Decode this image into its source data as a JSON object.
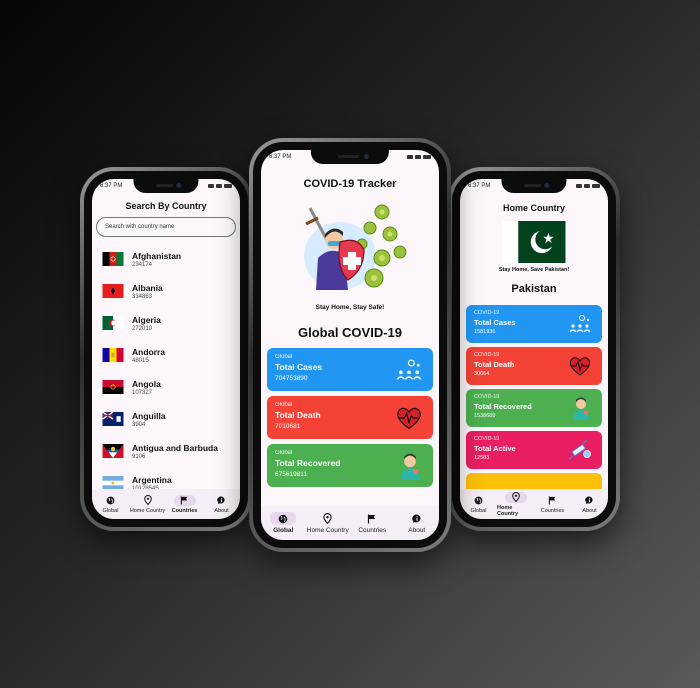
{
  "nav": [
    "Global",
    "Home Country",
    "Countries",
    "About"
  ],
  "left": {
    "time": "6:37 PM",
    "title": "Search By Country",
    "search_placeholder": "Search with country name",
    "countries": [
      {
        "name": "Afghanistan",
        "value": "234174"
      },
      {
        "name": "Albania",
        "value": "334863"
      },
      {
        "name": "Algeria",
        "value": "272010"
      },
      {
        "name": "Andorra",
        "value": "48015"
      },
      {
        "name": "Angola",
        "value": "107327"
      },
      {
        "name": "Anguilla",
        "value": "3904"
      },
      {
        "name": "Antigua and Barbuda",
        "value": "9106"
      },
      {
        "name": "Argentina",
        "value": "10128545"
      }
    ],
    "active_nav": "Countries"
  },
  "middle": {
    "time": "6:37 PM",
    "title": "COVID-19 Tracker",
    "tagline": "Stay Home, Stay Safe!",
    "section_title": "Global COVID-19",
    "cards": [
      {
        "small": "Global",
        "title": "Total Cases",
        "value": "704753890",
        "color": "#2196f3"
      },
      {
        "small": "Global",
        "title": "Total Death",
        "value": "7010681",
        "color": "#f44336"
      },
      {
        "small": "Global",
        "title": "Total Recovered",
        "value": "675619811",
        "color": "#4caf50"
      }
    ],
    "active_nav": "Global"
  },
  "right": {
    "time": "6:37 PM",
    "title": "Home Country",
    "tagline": "Stay Home, Save Pakistan!",
    "country": "Pakistan",
    "cards": [
      {
        "small": "COVID-19",
        "title": "Total Cases",
        "value": "1581936",
        "color": "#2196f3"
      },
      {
        "small": "COVID-19",
        "title": "Total Death",
        "value": "30664",
        "color": "#f44336"
      },
      {
        "small": "COVID-19",
        "title": "Total Recovered",
        "value": "1538689",
        "color": "#4caf50"
      },
      {
        "small": "COVID-19",
        "title": "Total Active",
        "value": "12583",
        "color": "#e91e63"
      }
    ],
    "active_nav": "Home Country"
  }
}
